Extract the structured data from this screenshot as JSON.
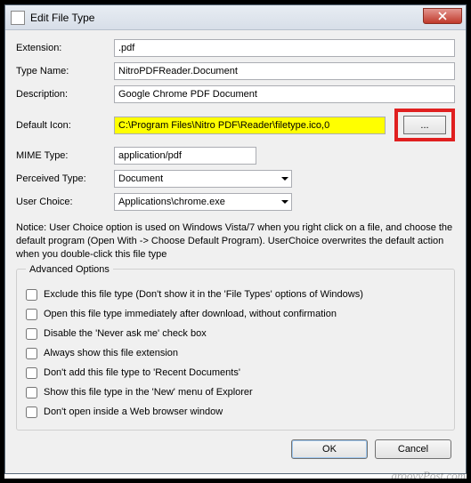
{
  "window": {
    "title": "Edit File Type"
  },
  "fields": {
    "extension": {
      "label": "Extension:",
      "value": ".pdf"
    },
    "type_name": {
      "label": "Type Name:",
      "value": "NitroPDFReader.Document"
    },
    "description": {
      "label": "Description:",
      "value": "Google Chrome PDF Document"
    },
    "default_icon": {
      "label": "Default Icon:",
      "value": "C:\\Program Files\\Nitro PDF\\Reader\\filetype.ico,0",
      "browse_label": "..."
    },
    "mime_type": {
      "label": "MIME Type:",
      "value": "application/pdf"
    },
    "perceived_type": {
      "label": "Perceived Type:",
      "value": "Document"
    },
    "user_choice": {
      "label": "User Choice:",
      "value": "Applications\\chrome.exe"
    }
  },
  "notice": "Notice: User Choice option is used on Windows Vista/7 when you right click on a file, and choose the default program (Open With -> Choose Default Program). UserChoice overwrites the default action when you double-click this file type",
  "advanced": {
    "legend": "Advanced Options",
    "options": [
      "Exclude  this file type (Don't show it in the 'File Types' options of Windows)",
      "Open this file type immediately after download, without confirmation",
      "Disable the 'Never ask me' check box",
      "Always show this file extension",
      "Don't add this file type to 'Recent Documents'",
      "Show this file type in the 'New' menu of Explorer",
      "Don't open inside a Web browser window"
    ]
  },
  "buttons": {
    "ok": "OK",
    "cancel": "Cancel"
  },
  "watermark": "groovyPost.com"
}
